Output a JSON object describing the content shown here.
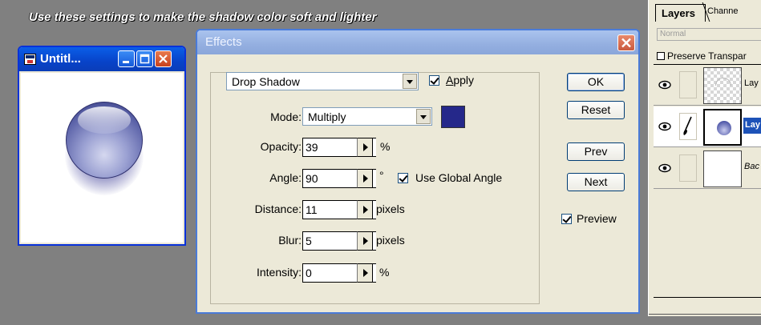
{
  "caption": "Use these settings to make the shadow color soft and lighter",
  "doc_window": {
    "title": "Untitl..."
  },
  "effects_dialog": {
    "title": "Effects",
    "effect_select": "Drop Shadow",
    "apply_label": "Apply",
    "apply_checked": true,
    "mode_label": "Mode:",
    "mode_value": "Multiply",
    "shadow_color": "#25288a",
    "opacity_label": "Opacity:",
    "opacity_value": "39",
    "opacity_unit": "%",
    "angle_label": "Angle:",
    "angle_value": "90",
    "angle_unit": "°",
    "use_global_angle_label": "Use Global Angle",
    "use_global_angle_checked": true,
    "distance_label": "Distance:",
    "distance_value": "11",
    "distance_unit": "pixels",
    "blur_label": "Blur:",
    "blur_value": "5",
    "blur_unit": "pixels",
    "intensity_label": "Intensity:",
    "intensity_value": "0",
    "intensity_unit": "%",
    "buttons": {
      "ok": "OK",
      "reset": "Reset",
      "prev": "Prev",
      "next": "Next"
    },
    "preview_label": "Preview",
    "preview_checked": true
  },
  "layers_panel": {
    "tab_layers": "Layers",
    "tab_channels": "Channe",
    "blend_mode": "Normal",
    "preserve_label": "Preserve Transpar",
    "layers": [
      {
        "name": "Lay",
        "visible": true,
        "selected": false
      },
      {
        "name": "Lay",
        "visible": true,
        "selected": true
      },
      {
        "name": "Bac",
        "visible": true,
        "selected": false
      }
    ]
  },
  "colors": {
    "xp_blue": "#0a5fe8",
    "dialog_inactive_title": "#94afe0",
    "face": "#ece9d8",
    "selection": "#1d52b8"
  }
}
